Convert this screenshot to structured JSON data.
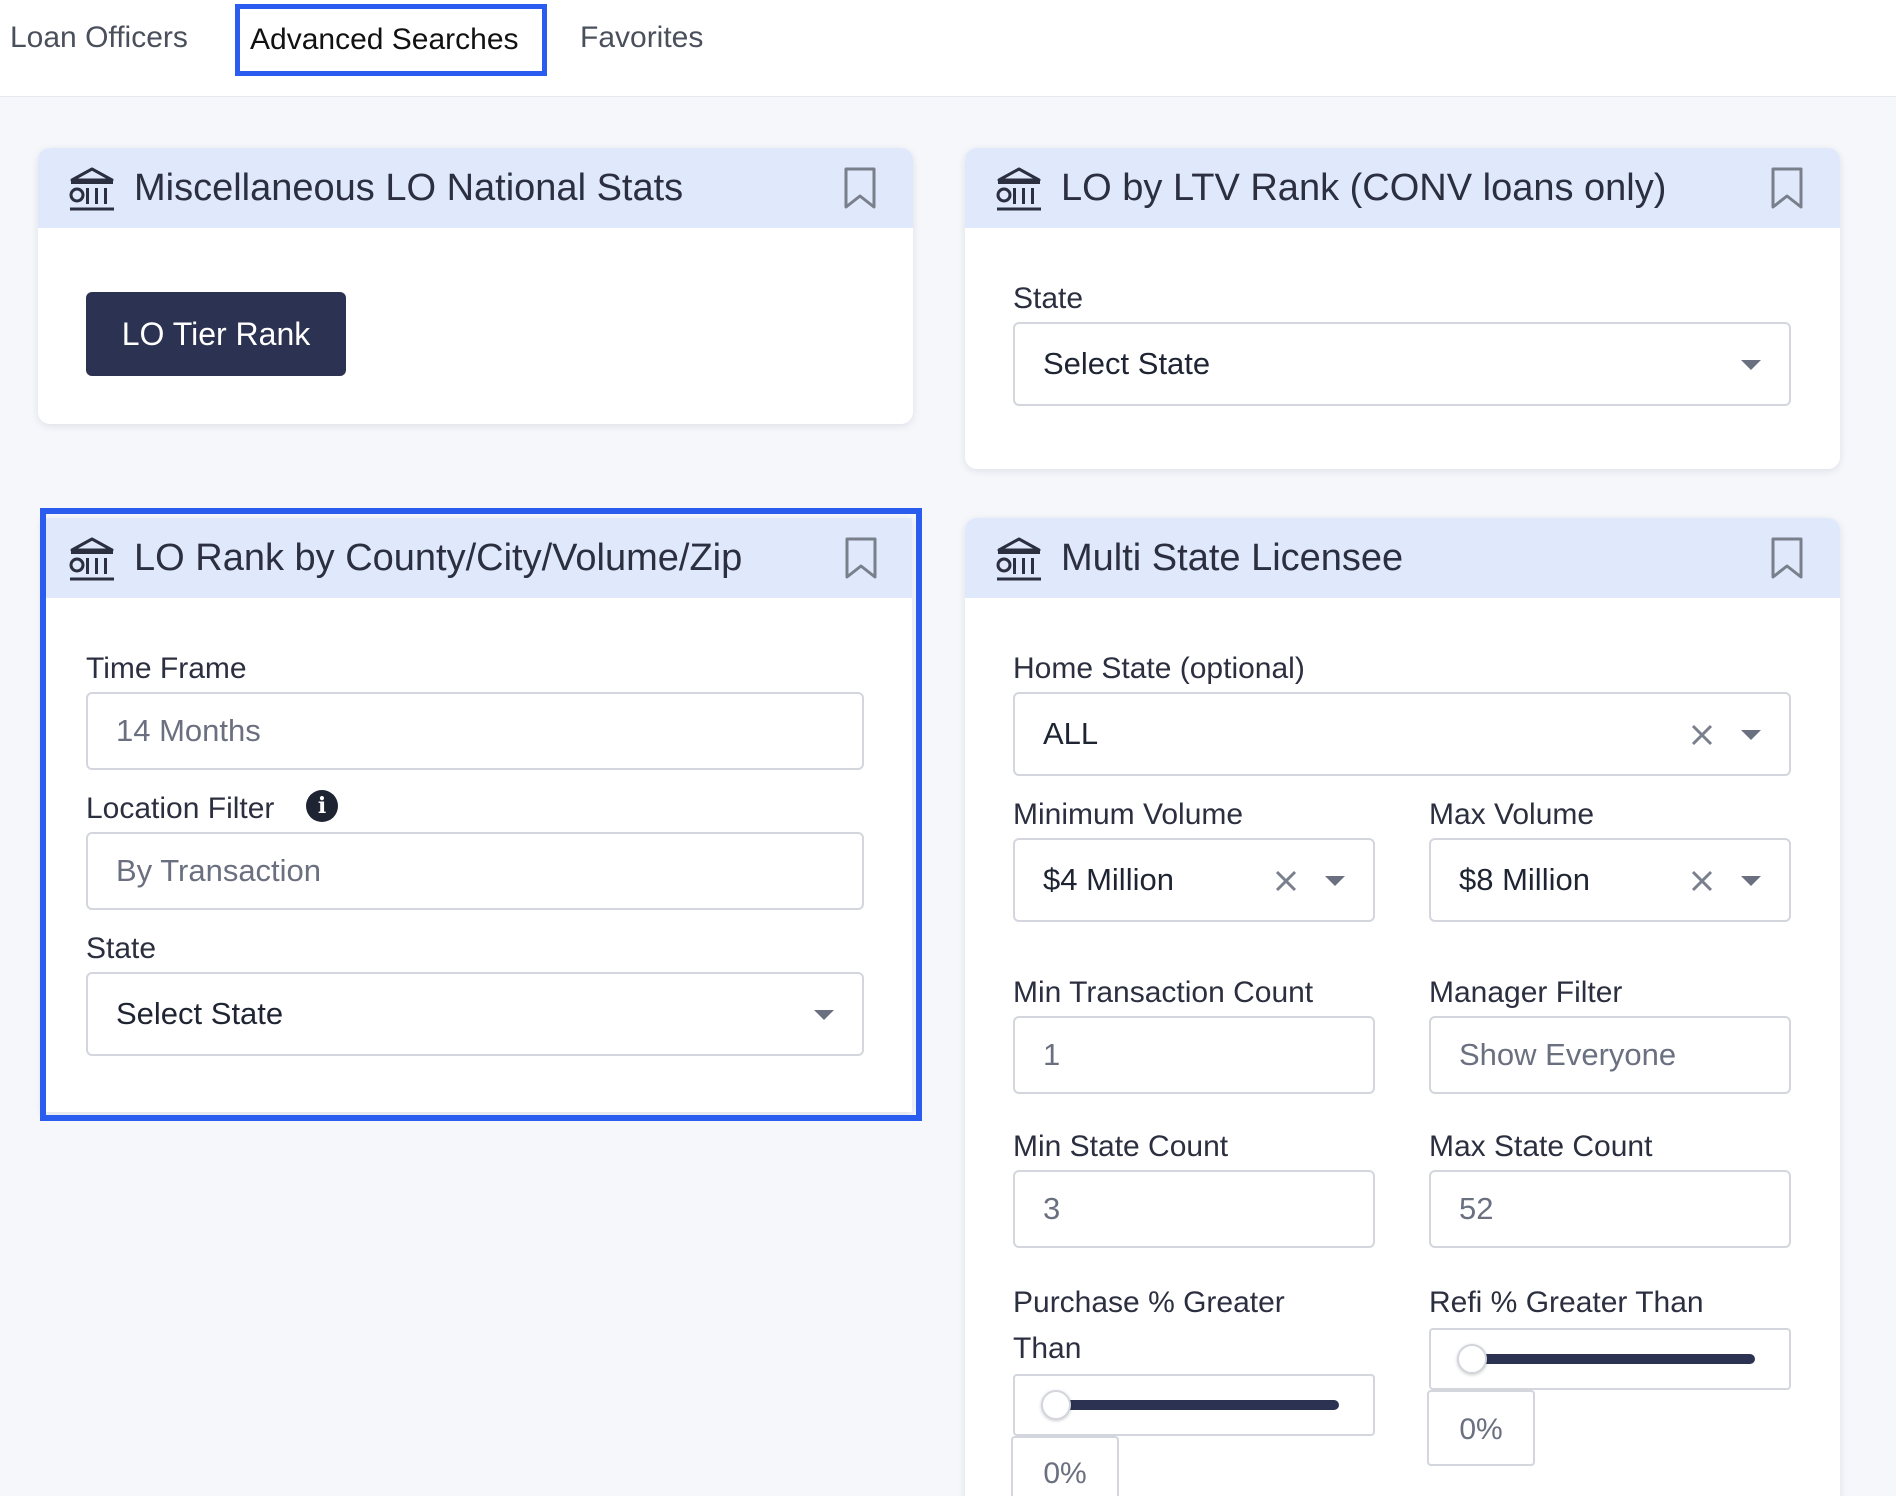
{
  "tabs": [
    {
      "label": "Loan Officers"
    },
    {
      "label": "Advanced Searches",
      "active": true
    },
    {
      "label": "Favorites"
    }
  ],
  "cards": {
    "misc": {
      "title": "Miscellaneous LO National Stats",
      "button": "LO Tier Rank"
    },
    "ltv": {
      "title": "LO by LTV Rank (CONV loans only)",
      "state_label": "State",
      "state_value": "Select State"
    },
    "county": {
      "title": "LO Rank by County/City/Volume/Zip",
      "time_frame_label": "Time Frame",
      "time_frame_value": "14 Months",
      "location_label": "Location Filter",
      "location_value": "By Transaction",
      "state_label": "State",
      "state_value": "Select State"
    },
    "multi": {
      "title": "Multi State Licensee",
      "home_state_label": "Home State (optional)",
      "home_state_value": "ALL",
      "min_volume_label": "Minimum Volume",
      "min_volume_value": "$4 Million",
      "max_volume_label": "Max Volume",
      "max_volume_value": "$8 Million",
      "min_tx_label": "Min Transaction Count",
      "min_tx_value": "1",
      "manager_label": "Manager Filter",
      "manager_value": "Show Everyone",
      "min_state_label": "Min State Count",
      "min_state_value": "3",
      "max_state_label": "Max State Count",
      "max_state_value": "52",
      "purchase_label_1": "Purchase % Greater",
      "purchase_label_2": "Than",
      "purchase_value": "0%",
      "purchase_level": 0,
      "refi_label": "Refi % Greater Than",
      "refi_value": "0%",
      "refi_level": 0
    }
  },
  "icons": {
    "card_icon": "bank-building-icon",
    "bookmark": "bookmark-icon",
    "info": "info-icon",
    "clear": "close-icon",
    "caret": "chevron-down-icon"
  }
}
